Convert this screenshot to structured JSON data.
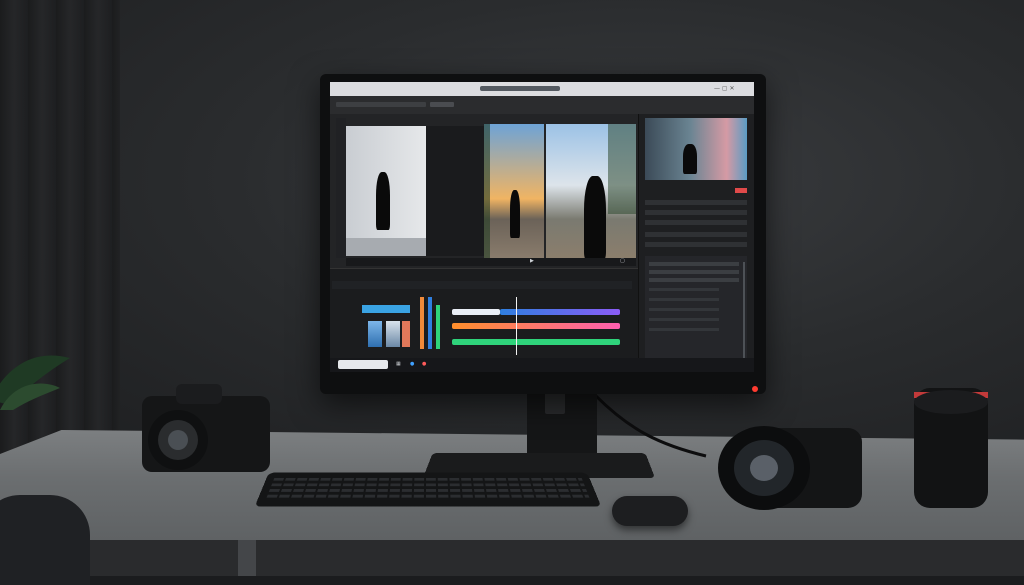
{
  "scene": {
    "description_elements": [
      "monitor",
      "video-editor",
      "camera",
      "lens",
      "lens",
      "keyboard",
      "mouse",
      "plant",
      "desk"
    ]
  },
  "editor": {
    "window_title": "",
    "menu_items": [],
    "taskbar_search_placeholder": ""
  },
  "colors": {
    "accent_red": "#ff3b30",
    "track_colors": [
      "#2f7fe0",
      "#ff8f2b",
      "#2fd37b",
      "#8b5cf6",
      "#ff5fb0"
    ]
  }
}
